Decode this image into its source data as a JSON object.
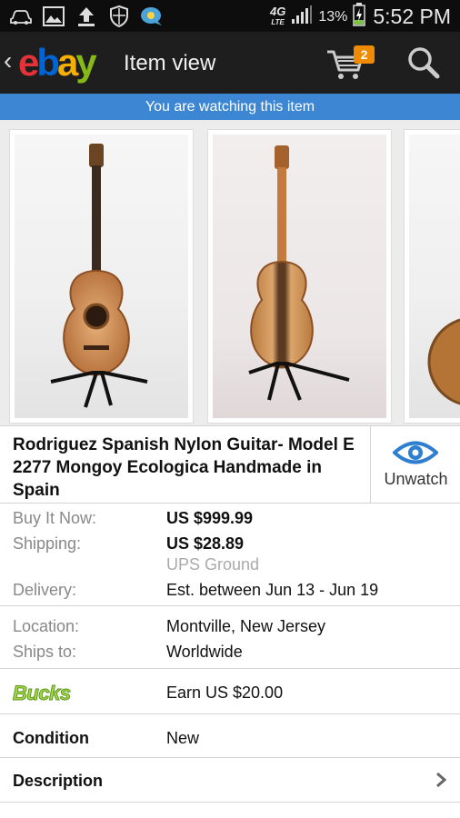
{
  "status_bar": {
    "network": "4G",
    "network_sub": "LTE",
    "battery_percent": "13%",
    "time": "5:52 PM",
    "icons": [
      "car-icon",
      "image-icon",
      "upload-icon",
      "shield-icon",
      "chat-bubble-icon",
      "signal-icon",
      "battery-charging-icon"
    ]
  },
  "action_bar": {
    "logo_letters": [
      "e",
      "b",
      "a",
      "y"
    ],
    "title": "Item view",
    "cart_count": "2",
    "icons": [
      "back-caret-icon",
      "cart-icon",
      "search-icon"
    ]
  },
  "banner": {
    "text": "You are watching this item"
  },
  "listing": {
    "title": "Rodriguez Spanish Nylon Guitar- Model E 2277 Mongoy Ecologica Handmade in Spain",
    "unwatch_label": "Unwatch",
    "buy_it_now_label": "Buy It Now:",
    "buy_it_now_value": "US $999.99",
    "shipping_label": "Shipping:",
    "shipping_value": "US $28.89",
    "shipping_service": "UPS Ground",
    "delivery_label": "Delivery:",
    "delivery_value": "Est. between Jun 13 - Jun 19",
    "location_label": "Location:",
    "location_value": "Montville, New Jersey",
    "ships_to_label": "Ships to:",
    "ships_to_value": "Worldwide",
    "bucks_logo": "Bucks",
    "bucks_value": "Earn US $20.00",
    "condition_label": "Condition",
    "condition_value": "New",
    "description_label": "Description"
  },
  "colors": {
    "action_bar": "#1e1e1e",
    "banner": "#3d86d4",
    "cart_badge": "#f08a00",
    "unwatch_eye": "#2f7fd1",
    "bucks_green": "#8cc63f"
  }
}
